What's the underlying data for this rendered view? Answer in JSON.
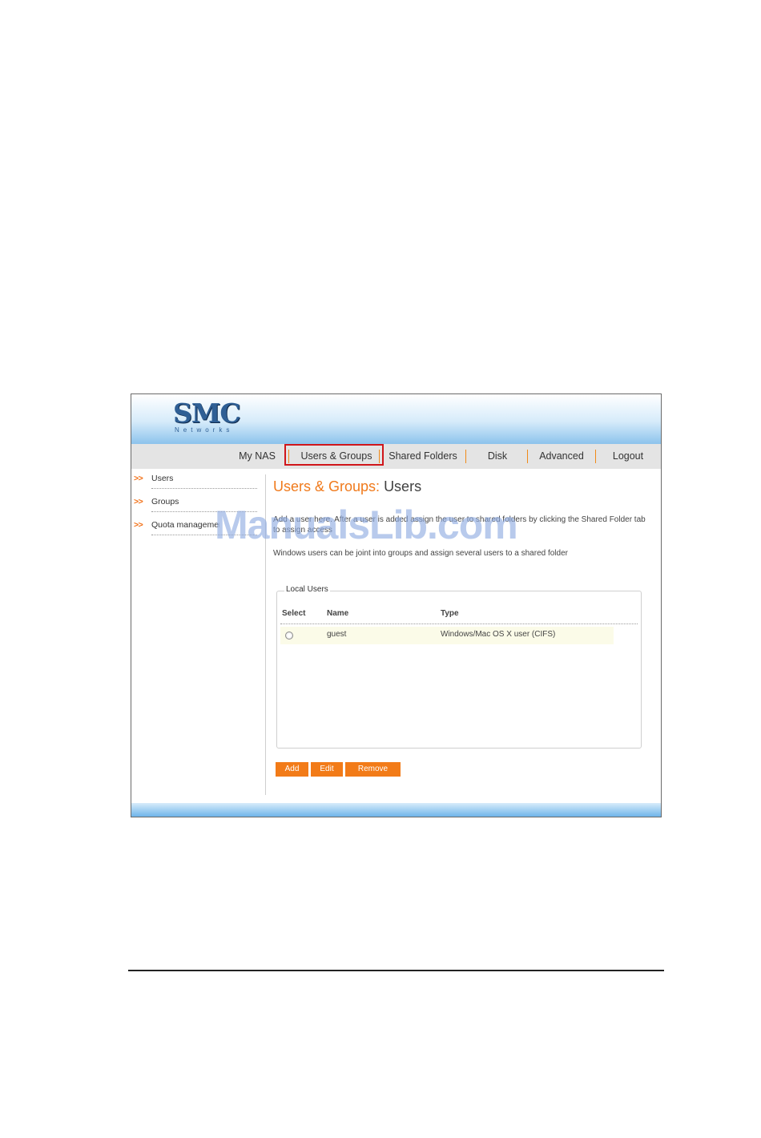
{
  "logo": {
    "main": "SMC",
    "sub": "Networks"
  },
  "nav": {
    "items": [
      {
        "label": "My NAS"
      },
      {
        "label": "Users & Groups"
      },
      {
        "label": "Shared Folders"
      },
      {
        "label": "Disk"
      },
      {
        "label": "Advanced"
      },
      {
        "label": "Logout"
      }
    ],
    "selected": "Users & Groups"
  },
  "sidebar": {
    "arrow": ">>",
    "items": [
      {
        "label": "Users"
      },
      {
        "label": "Groups"
      },
      {
        "label": "Quota management"
      }
    ]
  },
  "content": {
    "title_section": "Users & Groups:",
    "title_page": "Users",
    "desc1": "Add a user here. After a user is added assign the user to shared folders by clicking the Shared Folder tab to assign access",
    "desc2": "Windows users can be joint into groups and assign several users to a shared folder",
    "local_users": {
      "legend": "Local Users",
      "columns": [
        "Select",
        "Name",
        "Type"
      ],
      "rows": [
        {
          "name": "guest",
          "type": "Windows/Mac OS X user (CIFS)"
        }
      ]
    },
    "buttons": {
      "add": "Add",
      "edit": "Edit",
      "remove": "Remove"
    }
  },
  "watermark": "ManualsLib.com",
  "colors": {
    "accent": "#f27b18",
    "nav_highlight": "#d0161b",
    "logo": "#2f5f95"
  }
}
